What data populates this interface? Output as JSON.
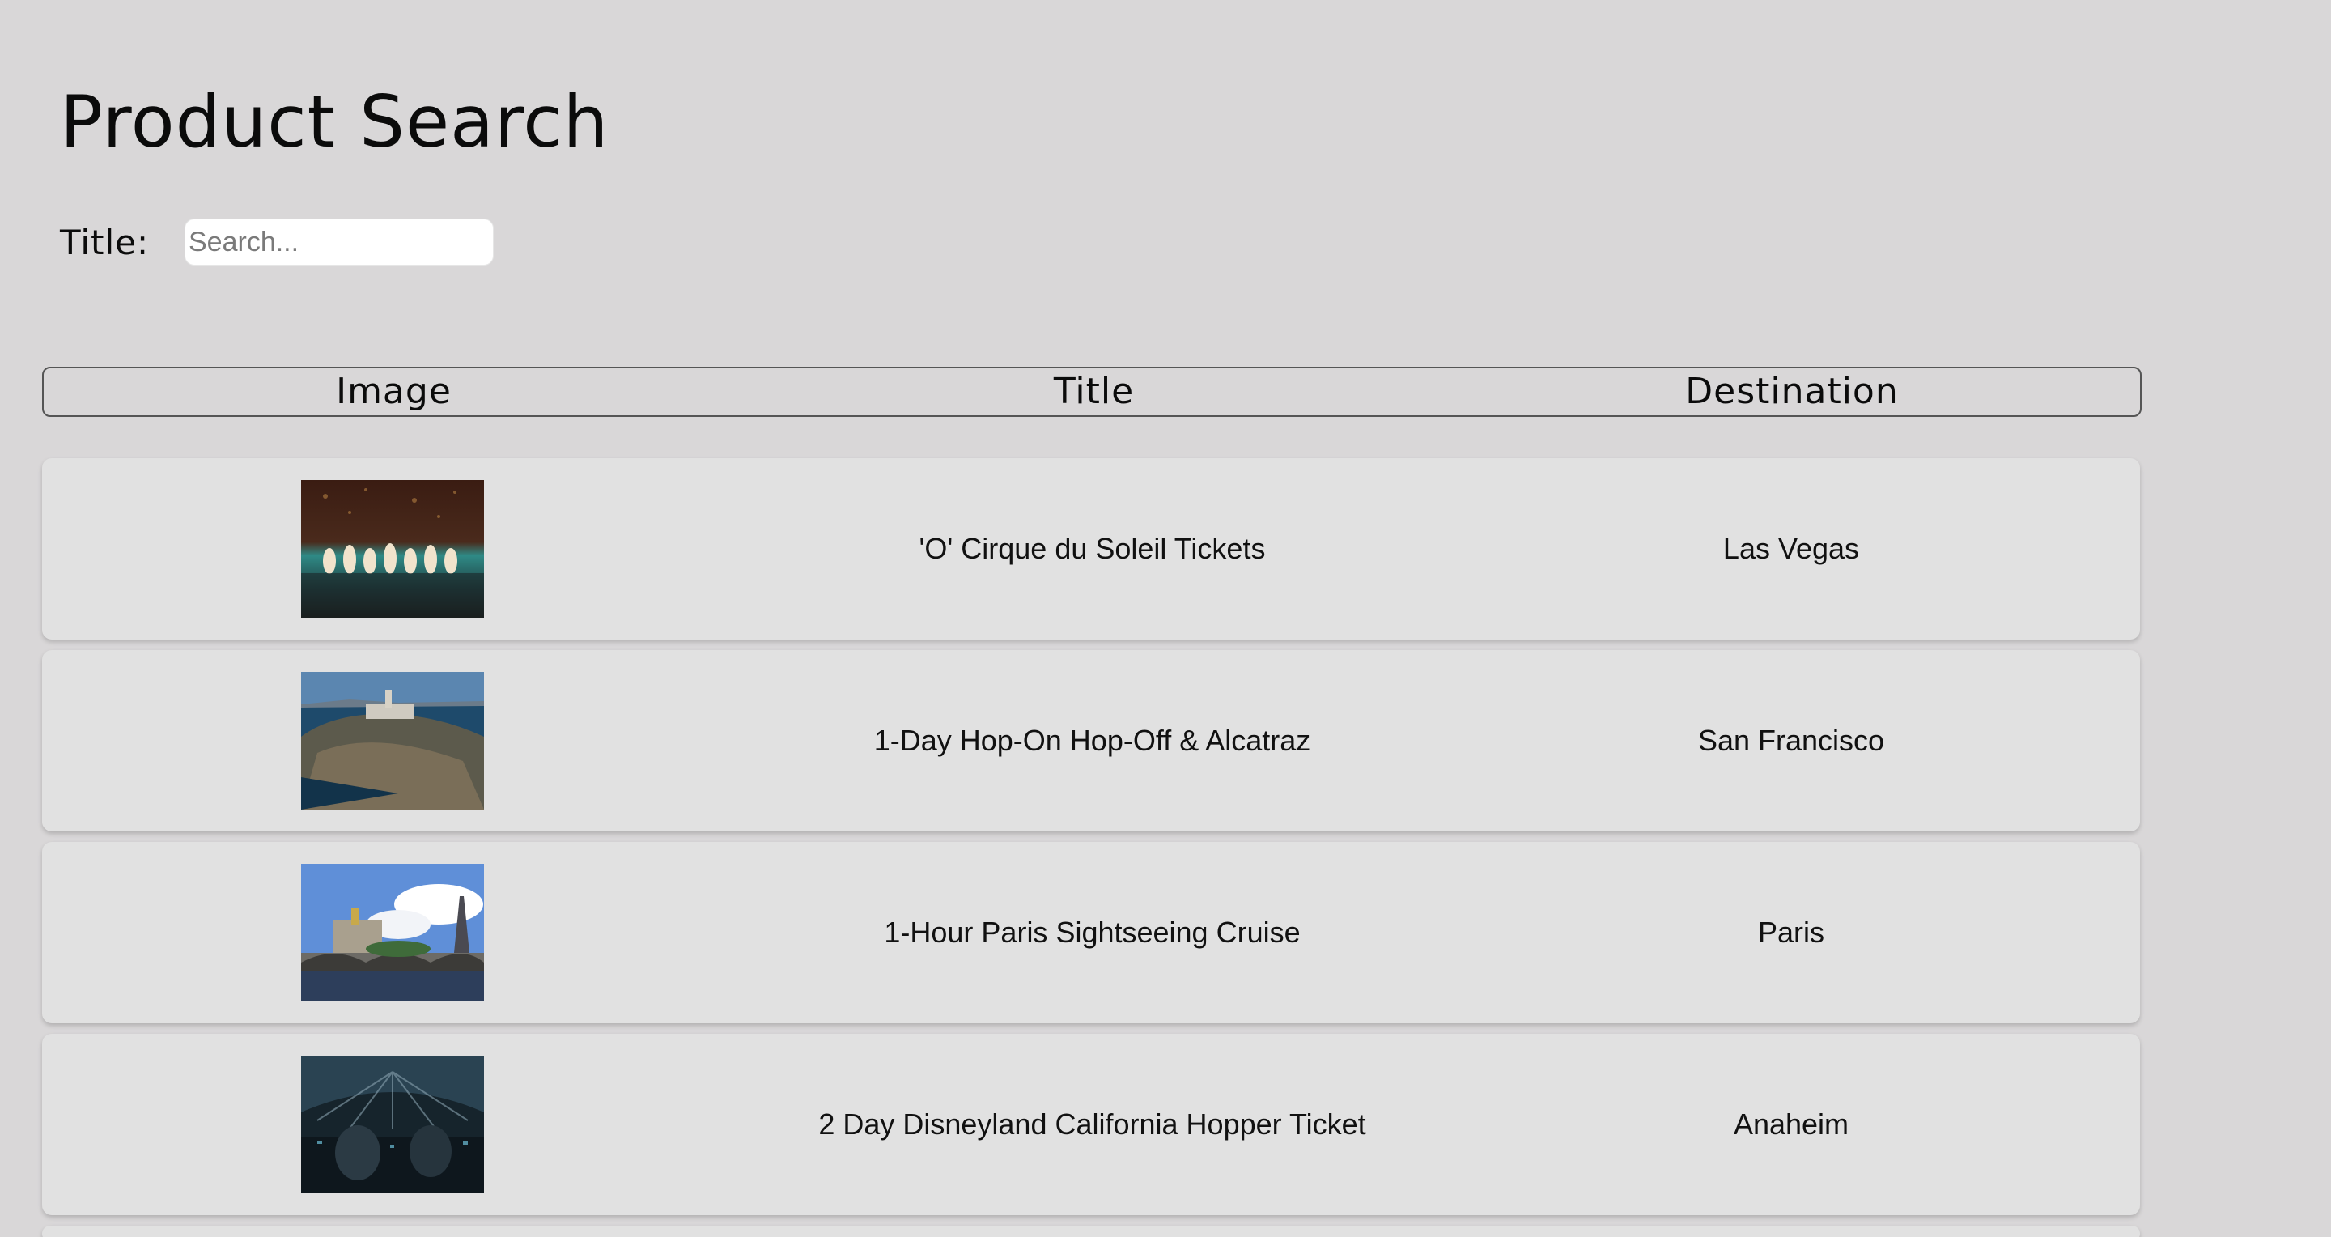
{
  "page": {
    "title": "Product Search"
  },
  "search": {
    "label": "Title:",
    "placeholder": "Search..."
  },
  "table": {
    "headers": [
      "Image",
      "Title",
      "Destination"
    ],
    "rows": [
      {
        "image_icon": "cirque-performance-photo",
        "title": "'O' Cirque du Soleil Tickets",
        "destination": "Las Vegas"
      },
      {
        "image_icon": "alcatraz-island-photo",
        "title": "1-Day Hop-On Hop-Off & Alcatraz",
        "destination": "San Francisco"
      },
      {
        "image_icon": "paris-eiffel-bridge-photo",
        "title": "1-Hour Paris Sightseeing Cruise",
        "destination": "Paris"
      },
      {
        "image_icon": "millennium-falcon-cockpit-photo",
        "title": "2 Day Disneyland California Hopper Ticket",
        "destination": "Anaheim"
      }
    ]
  }
}
